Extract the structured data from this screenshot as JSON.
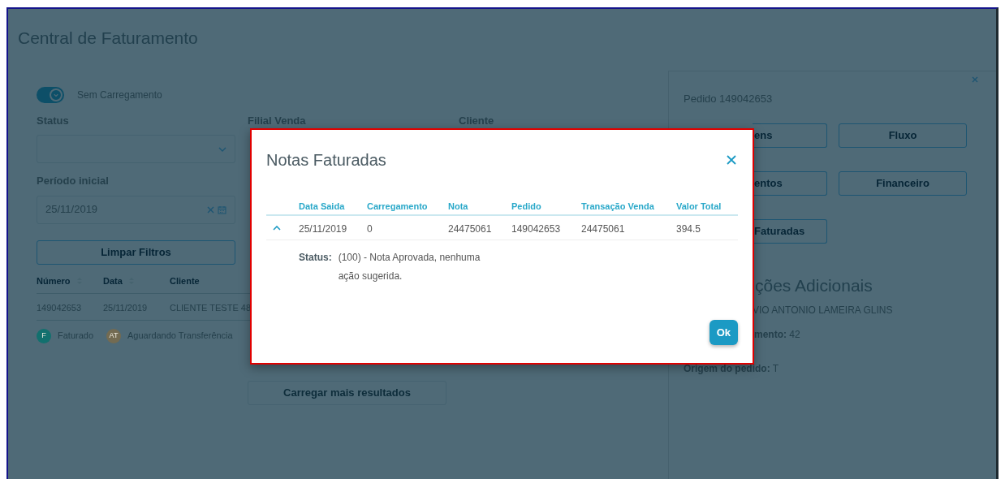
{
  "page": {
    "title": "Central de Faturamento"
  },
  "toggle": {
    "label": "Sem Carregamento",
    "on": true
  },
  "filters": [
    {
      "label": "Status",
      "kind": "select"
    },
    {
      "label": "Filial Venda",
      "kind": "hidden"
    },
    {
      "label": "Cliente",
      "kind": "hidden"
    },
    {
      "label": "Período inicial",
      "kind": "date",
      "value": "25/11/2019"
    }
  ],
  "buttons": {
    "clear": "Limpar Filtros",
    "load_more": "Carregar mais resultados"
  },
  "orders": {
    "columns": [
      {
        "label": "Número",
        "sortable": true
      },
      {
        "label": "Data",
        "sortable": true
      },
      {
        "label": "Cliente",
        "sortable": false
      }
    ],
    "rows": [
      [
        "149042653",
        "25/11/2019",
        "CLIENTE TESTE 48"
      ]
    ]
  },
  "legend": [
    {
      "badge": "F",
      "label": "Faturado",
      "color": "#12706e"
    },
    {
      "badge": "AT",
      "label": "Aguardando Transferência",
      "color": "#736b52"
    }
  ],
  "side_panel": {
    "title": "Pedido 149042653",
    "buttons": [
      "ens",
      "Fluxo",
      "entos",
      "Financeiro",
      "Faturadas"
    ],
    "heading": "ções Adicionais",
    "lines": [
      "VIO ANTONIO LAMEIRA GLINS",
      "**mento:** 42",
      "**Origem do pedido:** T"
    ]
  },
  "modal": {
    "title": "Notas Faturadas",
    "columns": [
      "Data Saida",
      "Carregamento",
      "Nota",
      "Pedido",
      "Transação Venda",
      "Valor Total"
    ],
    "rows": [
      {
        "expanded": true,
        "cells": [
          "25/11/2019",
          "0",
          "24475061",
          "149042653",
          "24475061",
          "394.5"
        ],
        "detail": {
          "label": "Status:",
          "text": "(100) - Nota Aprovada, nenhuma ação sugerida."
        }
      }
    ],
    "ok_button": "Ok"
  }
}
